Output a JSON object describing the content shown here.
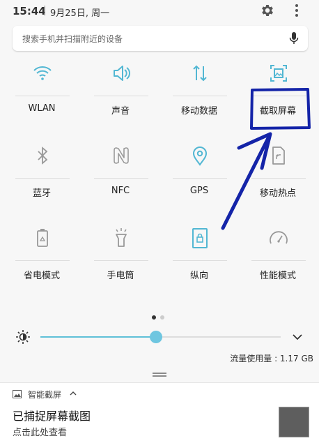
{
  "status": {
    "time": "15:44",
    "date": "9月25日, 周一"
  },
  "search": {
    "placeholder": "搜索手机并扫描附近的设备"
  },
  "tiles": [
    {
      "label": "WLAN",
      "icon": "wifi-icon"
    },
    {
      "label": "声音",
      "icon": "speaker-icon"
    },
    {
      "label": "移动数据",
      "icon": "mobile-data-icon"
    },
    {
      "label": "截取屏幕",
      "icon": "screenshot-icon"
    },
    {
      "label": "蓝牙",
      "icon": "bluetooth-icon"
    },
    {
      "label": "NFC",
      "icon": "nfc-icon"
    },
    {
      "label": "GPS",
      "icon": "location-icon"
    },
    {
      "label": "移动热点",
      "icon": "hotspot-icon"
    },
    {
      "label": "省电模式",
      "icon": "power-saving-icon"
    },
    {
      "label": "手电筒",
      "icon": "flashlight-icon"
    },
    {
      "label": "纵向",
      "icon": "portrait-lock-icon"
    },
    {
      "label": "性能模式",
      "icon": "performance-icon"
    }
  ],
  "brightness": {
    "level": 0.48
  },
  "data_usage": "流量使用量 : 1.17 GB",
  "notification": {
    "app": "智能截屏",
    "title": "已捕捉屏幕截图",
    "subtitle": "点击此处查看"
  },
  "colors": {
    "accent": "#52b7d3",
    "annotation": "#1424a8"
  }
}
